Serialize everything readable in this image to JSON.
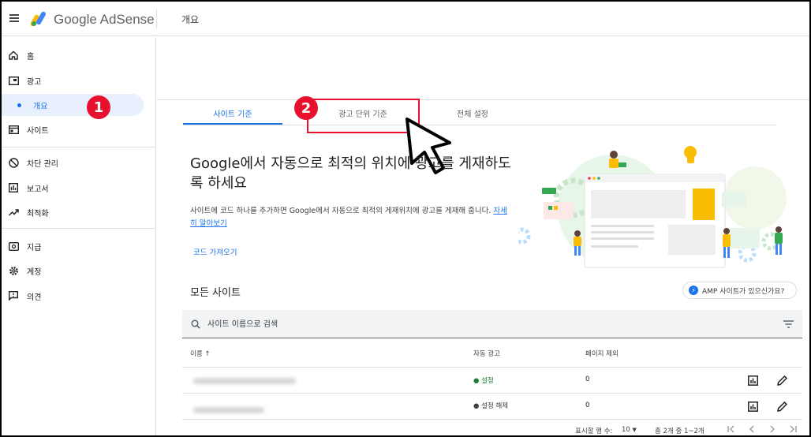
{
  "header": {
    "app_name": "Google AdSense",
    "page_title": "개요"
  },
  "sidebar": {
    "items": [
      {
        "label": "홈",
        "icon": "home-icon"
      },
      {
        "label": "광고",
        "icon": "ads-icon"
      },
      {
        "label": "개요",
        "icon": "dot",
        "active": true
      },
      {
        "label": "사이트",
        "icon": "sites-icon"
      },
      {
        "label": "차단 관리",
        "icon": "block-icon"
      },
      {
        "label": "보고서",
        "icon": "reports-icon"
      },
      {
        "label": "최적화",
        "icon": "optimize-icon"
      },
      {
        "label": "지급",
        "icon": "payments-icon"
      },
      {
        "label": "계정",
        "icon": "gear-icon"
      },
      {
        "label": "의견",
        "icon": "feedback-icon"
      }
    ]
  },
  "annotations": {
    "badge1": "1",
    "badge2": "2",
    "badge_color": "#e8112d"
  },
  "tabs": [
    {
      "label": "사이트 기준",
      "active": true
    },
    {
      "label": "광고 단위 기준",
      "active": false
    },
    {
      "label": "전체 설정",
      "active": false
    }
  ],
  "hero": {
    "headline": "Google에서 자동으로 최적의 위치에 광고를 게재하도록 하세요",
    "description": "사이트에 코드 하나를 추가하면 Google에서 자동으로 최적의 게재위치에 광고를 게재해 줍니다.",
    "learn_more": "자세히 알아보기",
    "get_code": "코드 가져오기"
  },
  "sites": {
    "title": "모든 사이트",
    "amp_chip": "AMP 사이트가 있으신가요?",
    "search_placeholder": "사이트 이름으로 검색",
    "columns": {
      "name": "이름 ↑",
      "auto_ads": "자동 광고",
      "excluded_pages": "페이지 제외"
    },
    "rows": [
      {
        "status": "● 설정",
        "excluded": "0"
      },
      {
        "status": "● 설정 해제",
        "excluded": "0"
      }
    ],
    "footer": {
      "rows_per_page_label": "표시할 행 수:",
      "rows_per_page_value": "10",
      "range": "총 2개 중 1~2개"
    }
  },
  "colors": {
    "accent": "#1a73e8",
    "status_on": "#188038"
  }
}
